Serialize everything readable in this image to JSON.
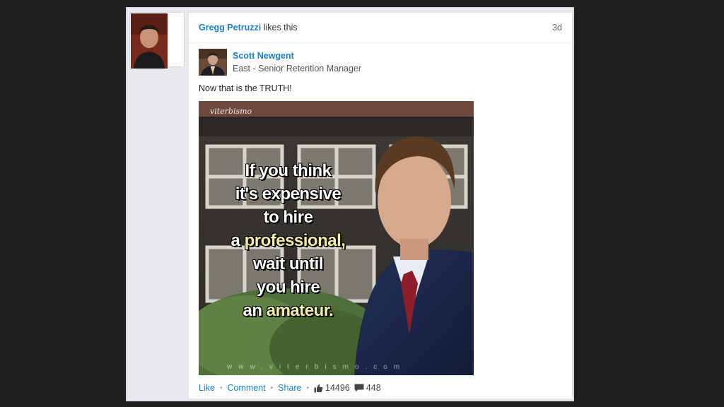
{
  "activity": {
    "actor_name": "Gregg Petruzzi",
    "action_text": "likes this",
    "time_ago": "3d"
  },
  "post": {
    "author_name": "Scott Newgent",
    "author_title": "East - Senior Retention Manager",
    "text": "Now that is the TRUTH!",
    "image": {
      "watermark_top": "viterbismo",
      "watermark_bottom": "www.viterbismo.com",
      "lines": [
        {
          "text": "If you think",
          "highlight": false
        },
        {
          "text": "it's expensive",
          "highlight": false
        },
        {
          "text": "to hire",
          "highlight": false
        },
        {
          "pre": "a ",
          "text": "professional,",
          "highlight": true
        },
        {
          "text": "wait until",
          "highlight": false
        },
        {
          "text": "you hire",
          "highlight": false
        },
        {
          "pre": "an ",
          "text": "amateur.",
          "highlight": true
        }
      ]
    }
  },
  "actions": {
    "like_label": "Like",
    "comment_label": "Comment",
    "share_label": "Share",
    "separator": "•",
    "likes_count": "14496",
    "comments_count": "448"
  }
}
